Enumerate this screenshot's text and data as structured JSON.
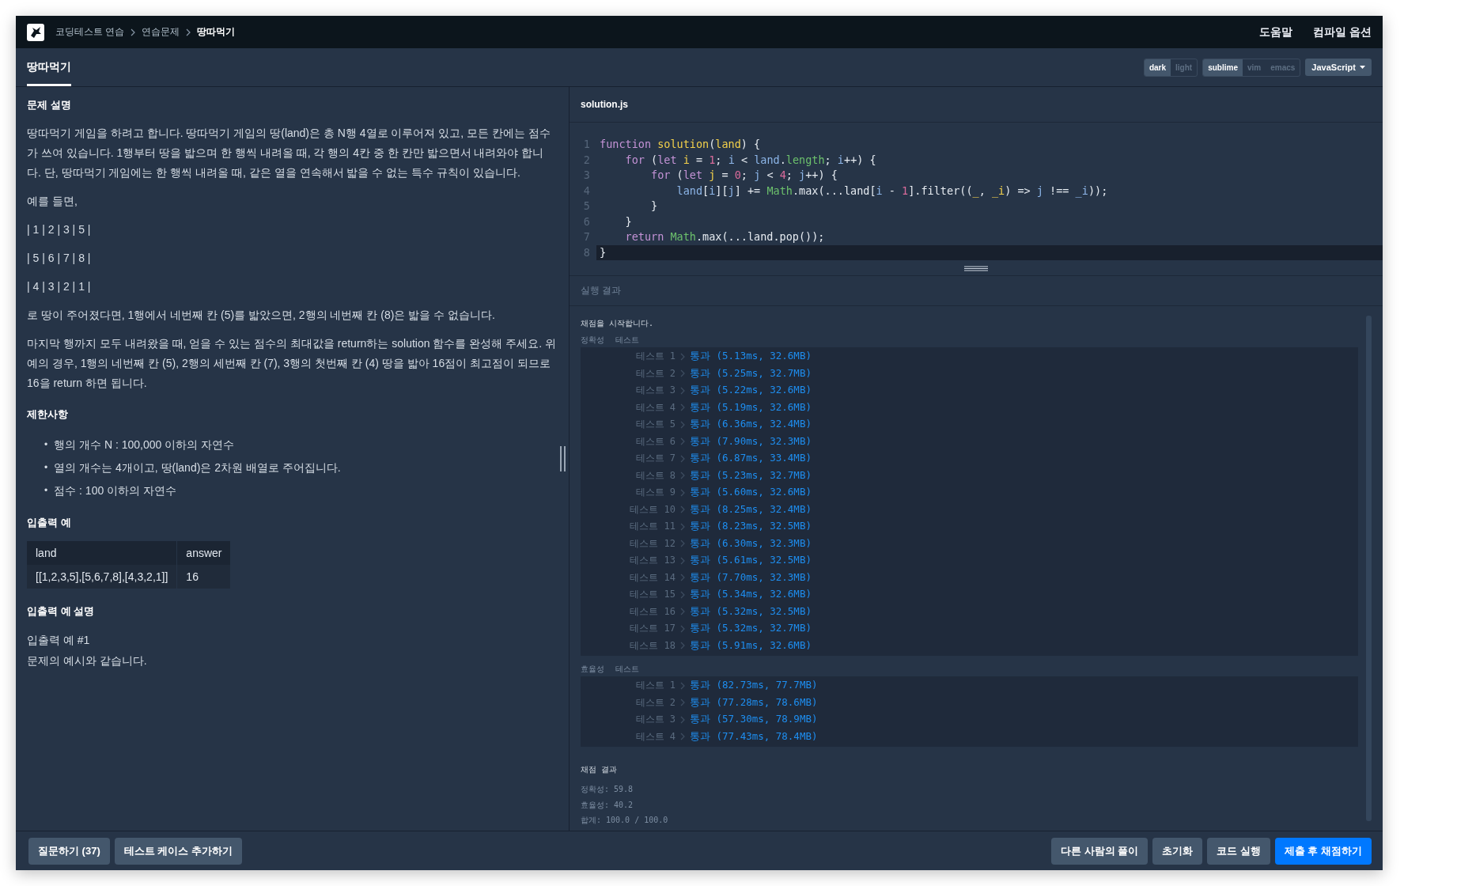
{
  "header": {
    "breadcrumbs": [
      "코딩테스트 연습",
      "연습문제",
      "땅따먹기"
    ],
    "links": [
      "도움말",
      "컴파일 옵션"
    ]
  },
  "tabs": [
    {
      "label": "땅따먹기",
      "selected": true
    }
  ],
  "editor_options": {
    "themes": [
      {
        "label": "dark",
        "selected": true
      },
      {
        "label": "light",
        "selected": false
      }
    ],
    "keymaps": [
      {
        "label": "sublime",
        "selected": true
      },
      {
        "label": "vim",
        "selected": false
      },
      {
        "label": "emacs",
        "selected": false
      }
    ],
    "language": "JavaScript"
  },
  "problem": {
    "sections": [
      {
        "title": "문제 설명",
        "kind": "paragraphs",
        "items": [
          "땅따먹기 게임을 하려고 합니다. 땅따먹기 게임의 땅(land)은 총 N행 4열로 이루어져 있고, 모든 칸에는 점수가 쓰여 있습니다. 1행부터 땅을 밟으며 한 행씩 내려올 때, 각 행의 4칸 중 한 칸만 밟으면서 내려와야 합니다. 단, 땅따먹기 게임에는 한 행씩 내려올 때, 같은 열을 연속해서 밟을 수 없는 특수 규칙이 있습니다.",
          "예를 들면,",
          "| 1 | 2 | 3 | 5 |",
          "| 5 | 6 | 7 | 8 |",
          "| 4 | 3 | 2 | 1 |",
          "로 땅이 주어졌다면, 1행에서 네번째 칸 (5)를 밟았으면, 2행의 네번째 칸 (8)은 밟을 수 없습니다.",
          "마지막 행까지 모두 내려왔을 때, 얻을 수 있는 점수의 최대값을 return하는 solution 함수를 완성해 주세요. 위 예의 경우, 1행의 네번째 칸 (5), 2행의 세번째 칸 (7), 3행의 첫번째 칸 (4) 땅을 밟아 16점이 최고점이 되므로 16을 return 하면 됩니다."
        ]
      },
      {
        "title": "제한사항",
        "kind": "bullets",
        "marker": "•",
        "items": [
          "행의 개수 N : 100,000 이하의 자연수",
          "열의 개수는 4개이고, 땅(land)은 2차원 배열로 주어집니다.",
          "점수 : 100 이하의 자연수"
        ]
      },
      {
        "title": "입출력 예",
        "kind": "table",
        "columns": [
          "land",
          "answer"
        ],
        "rows": [
          [
            "[[1,2,3,5],[5,6,7,8],[4,3,2,1]]",
            "16"
          ]
        ]
      },
      {
        "title": "입출력 예 설명",
        "kind": "lines",
        "items": [
          "입출력 예 #1",
          "문제의 예시와 같습니다."
        ]
      }
    ]
  },
  "editor": {
    "filename": "solution.js",
    "lines": [
      {
        "number": "1",
        "active": false,
        "tokens": [
          {
            "text": "function",
            "kind": "kw"
          },
          {
            "text": " solution",
            "kind": "def"
          },
          {
            "text": "(",
            "kind": "plain"
          },
          {
            "text": "land",
            "kind": "def"
          },
          {
            "text": ") {",
            "kind": "plain"
          }
        ]
      },
      {
        "number": "2",
        "active": false,
        "tokens": [
          {
            "text": "    for",
            "kind": "kw"
          },
          {
            "text": " (",
            "kind": "plain"
          },
          {
            "text": "let",
            "kind": "kw"
          },
          {
            "text": " i",
            "kind": "def"
          },
          {
            "text": " = ",
            "kind": "plain"
          },
          {
            "text": "1",
            "kind": "num"
          },
          {
            "text": "; ",
            "kind": "plain"
          },
          {
            "text": "i",
            "kind": "var"
          },
          {
            "text": " < ",
            "kind": "plain"
          },
          {
            "text": "land",
            "kind": "var"
          },
          {
            "text": ".",
            "kind": "plain"
          },
          {
            "text": "length",
            "kind": "prop"
          },
          {
            "text": "; ",
            "kind": "plain"
          },
          {
            "text": "i",
            "kind": "var"
          },
          {
            "text": "++) {",
            "kind": "plain"
          }
        ]
      },
      {
        "number": "3",
        "active": false,
        "tokens": [
          {
            "text": "        for",
            "kind": "kw"
          },
          {
            "text": " (",
            "kind": "plain"
          },
          {
            "text": "let",
            "kind": "kw"
          },
          {
            "text": " j",
            "kind": "def"
          },
          {
            "text": " = ",
            "kind": "plain"
          },
          {
            "text": "0",
            "kind": "num"
          },
          {
            "text": "; ",
            "kind": "plain"
          },
          {
            "text": "j",
            "kind": "var"
          },
          {
            "text": " < ",
            "kind": "plain"
          },
          {
            "text": "4",
            "kind": "num"
          },
          {
            "text": "; ",
            "kind": "plain"
          },
          {
            "text": "j",
            "kind": "var"
          },
          {
            "text": "++) {",
            "kind": "plain"
          }
        ]
      },
      {
        "number": "4",
        "active": false,
        "tokens": [
          {
            "text": "            land",
            "kind": "var"
          },
          {
            "text": "[",
            "kind": "plain"
          },
          {
            "text": "i",
            "kind": "var"
          },
          {
            "text": "][",
            "kind": "plain"
          },
          {
            "text": "j",
            "kind": "var"
          },
          {
            "text": "] += ",
            "kind": "plain"
          },
          {
            "text": "Math",
            "kind": "prop"
          },
          {
            "text": ".max(...land[",
            "kind": "plain"
          },
          {
            "text": "i",
            "kind": "var"
          },
          {
            "text": " - ",
            "kind": "plain"
          },
          {
            "text": "1",
            "kind": "num"
          },
          {
            "text": "].filter((",
            "kind": "plain"
          },
          {
            "text": "_",
            "kind": "def"
          },
          {
            "text": ", ",
            "kind": "plain"
          },
          {
            "text": "_i",
            "kind": "def"
          },
          {
            "text": ") => ",
            "kind": "plain"
          },
          {
            "text": "j",
            "kind": "var"
          },
          {
            "text": " !== ",
            "kind": "plain"
          },
          {
            "text": "_i",
            "kind": "var"
          },
          {
            "text": "));",
            "kind": "plain"
          }
        ]
      },
      {
        "number": "5",
        "active": false,
        "tokens": [
          {
            "text": "        }",
            "kind": "plain"
          }
        ]
      },
      {
        "number": "6",
        "active": false,
        "tokens": [
          {
            "text": "    }",
            "kind": "plain"
          }
        ]
      },
      {
        "number": "7",
        "active": false,
        "tokens": [
          {
            "text": "    return",
            "kind": "kw"
          },
          {
            "text": " Math",
            "kind": "prop"
          },
          {
            "text": ".max(...land.pop());",
            "kind": "plain"
          }
        ]
      },
      {
        "number": "8",
        "active": true,
        "tokens": [
          {
            "text": "}",
            "kind": "plain"
          }
        ]
      }
    ]
  },
  "results": {
    "title": "실행 결과",
    "start_message": "채점을 시작합니다.",
    "groups": [
      {
        "name": "정확성",
        "label": "테스트",
        "tests": [
          {
            "label": "테스트 1",
            "result": "통과 (5.13ms, 32.6MB)"
          },
          {
            "label": "테스트 2",
            "result": "통과 (5.25ms, 32.7MB)"
          },
          {
            "label": "테스트 3",
            "result": "통과 (5.22ms, 32.6MB)"
          },
          {
            "label": "테스트 4",
            "result": "통과 (5.19ms, 32.6MB)"
          },
          {
            "label": "테스트 5",
            "result": "통과 (6.36ms, 32.4MB)"
          },
          {
            "label": "테스트 6",
            "result": "통과 (7.90ms, 32.3MB)"
          },
          {
            "label": "테스트 7",
            "result": "통과 (6.87ms, 33.4MB)"
          },
          {
            "label": "테스트 8",
            "result": "통과 (5.23ms, 32.7MB)"
          },
          {
            "label": "테스트 9",
            "result": "통과 (5.60ms, 32.6MB)"
          },
          {
            "label": "테스트 10",
            "result": "통과 (8.25ms, 32.4MB)"
          },
          {
            "label": "테스트 11",
            "result": "통과 (8.23ms, 32.5MB)"
          },
          {
            "label": "테스트 12",
            "result": "통과 (6.30ms, 32.3MB)"
          },
          {
            "label": "테스트 13",
            "result": "통과 (5.61ms, 32.5MB)"
          },
          {
            "label": "테스트 14",
            "result": "통과 (7.70ms, 32.3MB)"
          },
          {
            "label": "테스트 15",
            "result": "통과 (5.34ms, 32.6MB)"
          },
          {
            "label": "테스트 16",
            "result": "통과 (5.32ms, 32.5MB)"
          },
          {
            "label": "테스트 17",
            "result": "통과 (5.32ms, 32.7MB)"
          },
          {
            "label": "테스트 18",
            "result": "통과 (5.91ms, 32.6MB)"
          }
        ]
      },
      {
        "name": "효율성",
        "label": "테스트",
        "tests": [
          {
            "label": "테스트 1",
            "result": "통과 (82.73ms, 77.7MB)"
          },
          {
            "label": "테스트 2",
            "result": "통과 (77.28ms, 78.6MB)"
          },
          {
            "label": "테스트 3",
            "result": "통과 (57.30ms, 78.9MB)"
          },
          {
            "label": "테스트 4",
            "result": "통과 (77.43ms, 78.4MB)"
          }
        ]
      }
    ],
    "summary_title": "채점 결과",
    "summary": [
      "정확성: 59.8",
      "효율성: 40.2",
      "합계: 100.0 / 100.0"
    ]
  },
  "footer": {
    "left_buttons": [
      {
        "label": "질문하기 (37)",
        "kind": "secondary"
      },
      {
        "label": "테스트 케이스 추가하기",
        "kind": "secondary"
      }
    ],
    "right_buttons": [
      {
        "label": "다른 사람의 풀이",
        "kind": "secondary"
      },
      {
        "label": "초기화",
        "kind": "secondary"
      },
      {
        "label": "코드 실행",
        "kind": "secondary"
      },
      {
        "label": "제출 후 채점하기",
        "kind": "primary"
      }
    ]
  }
}
